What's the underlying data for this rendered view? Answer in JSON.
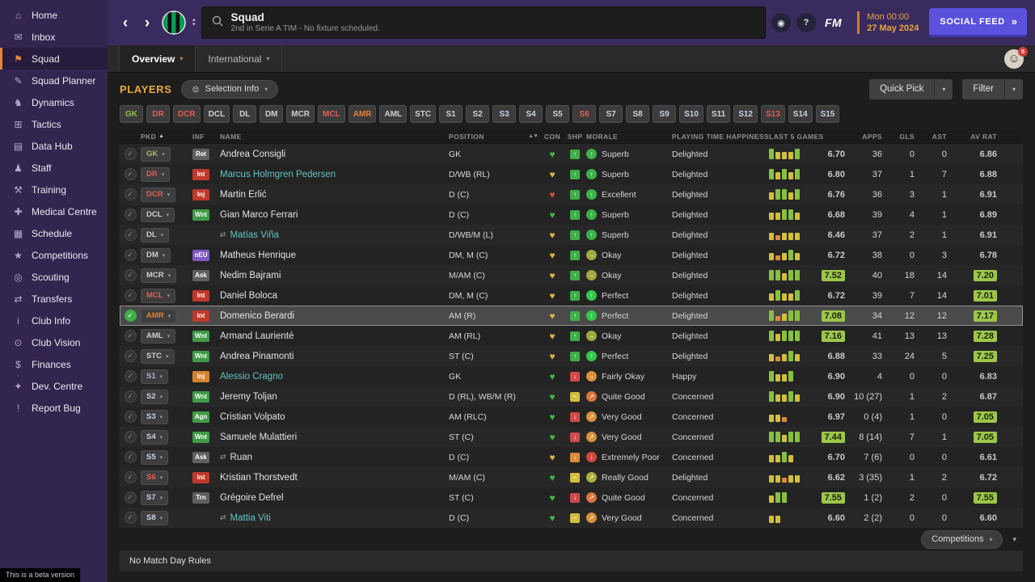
{
  "sidebar": {
    "items": [
      {
        "name": "home",
        "label": "Home",
        "glyph": "⌂"
      },
      {
        "name": "inbox",
        "label": "Inbox",
        "glyph": "✉"
      },
      {
        "name": "squad",
        "label": "Squad",
        "glyph": "⚑",
        "active": true
      },
      {
        "name": "squad-planner",
        "label": "Squad Planner",
        "glyph": "✎"
      },
      {
        "name": "dynamics",
        "label": "Dynamics",
        "glyph": "♞"
      },
      {
        "name": "tactics",
        "label": "Tactics",
        "glyph": "⊞"
      },
      {
        "name": "data-hub",
        "label": "Data Hub",
        "glyph": "▤"
      },
      {
        "name": "staff",
        "label": "Staff",
        "glyph": "♟"
      },
      {
        "name": "training",
        "label": "Training",
        "glyph": "⚒"
      },
      {
        "name": "medical-centre",
        "label": "Medical Centre",
        "glyph": "✚"
      },
      {
        "name": "schedule",
        "label": "Schedule",
        "glyph": "▦"
      },
      {
        "name": "competitions",
        "label": "Competitions",
        "glyph": "★"
      },
      {
        "name": "scouting",
        "label": "Scouting",
        "glyph": "◎"
      },
      {
        "name": "transfers",
        "label": "Transfers",
        "glyph": "⇄"
      },
      {
        "name": "club-info",
        "label": "Club Info",
        "glyph": "i"
      },
      {
        "name": "club-vision",
        "label": "Club Vision",
        "glyph": "⊙"
      },
      {
        "name": "finances",
        "label": "Finances",
        "glyph": "$"
      },
      {
        "name": "dev-centre",
        "label": "Dev. Centre",
        "glyph": "✦"
      },
      {
        "name": "report-bug",
        "label": "Report Bug",
        "glyph": "!"
      }
    ],
    "beta_note": "This is a beta version"
  },
  "topbar": {
    "title": "Squad",
    "subtitle": "2nd in Serie A TIM - No fixture scheduled.",
    "date_line1": "Mon 00:00",
    "date_line2": "27 May 2024",
    "social_feed_label": "SOCIAL FEED"
  },
  "tabbar": {
    "tabs": [
      {
        "label": "Overview"
      },
      {
        "label": "International"
      }
    ],
    "avatar_badge": "5"
  },
  "toolbar": {
    "players_label": "PLAYERS",
    "selection_info_label": "Selection Info",
    "quick_pick_label": "Quick Pick",
    "filter_label": "Filter"
  },
  "position_filters": [
    {
      "label": "GK",
      "color": "#8fbf4d"
    },
    {
      "label": "DR",
      "color": "#e06055"
    },
    {
      "label": "DCR",
      "color": "#e06055"
    },
    {
      "label": "DCL",
      "color": "#cfcfcf"
    },
    {
      "label": "DL",
      "color": "#cfcfcf"
    },
    {
      "label": "DM",
      "color": "#cfcfcf"
    },
    {
      "label": "MCR",
      "color": "#cfcfcf"
    },
    {
      "label": "MCL",
      "color": "#e06055"
    },
    {
      "label": "AMR",
      "color": "#e0813c"
    },
    {
      "label": "AML",
      "color": "#cfcfcf"
    },
    {
      "label": "STC",
      "color": "#cfcfcf"
    },
    {
      "label": "S1",
      "color": "#c9d1e4"
    },
    {
      "label": "S2",
      "color": "#c9d1e4"
    },
    {
      "label": "S3",
      "color": "#c9d1e4"
    },
    {
      "label": "S4",
      "color": "#c9d1e4"
    },
    {
      "label": "S5",
      "color": "#c9d1e4"
    },
    {
      "label": "S6",
      "color": "#e06055"
    },
    {
      "label": "S7",
      "color": "#c9d1e4"
    },
    {
      "label": "S8",
      "color": "#c9d1e4"
    },
    {
      "label": "S9",
      "color": "#c9d1e4"
    },
    {
      "label": "S10",
      "color": "#c9d1e4"
    },
    {
      "label": "S11",
      "color": "#c9d1e4"
    },
    {
      "label": "S12",
      "color": "#c9d1e4"
    },
    {
      "label": "S13",
      "color": "#e06055"
    },
    {
      "label": "S14",
      "color": "#c9d1e4"
    },
    {
      "label": "S15",
      "color": "#c9d1e4"
    }
  ],
  "table": {
    "columns": [
      "PKD",
      "INF",
      "NAME",
      "POSITION",
      "CON",
      "SHP",
      "MORALE",
      "PLAYING TIME HAPPINESS",
      "LAST 5 GAMES",
      "APPS",
      "GLS",
      "AST",
      "AV RAT"
    ],
    "rows": [
      {
        "pkd": "GK",
        "pkd_color": "#a8b868",
        "inf": "Ret",
        "inf_bg": "#5f5f5f",
        "name": "Andrea Consigli",
        "pos": "GK",
        "con": "green",
        "shp": "g",
        "morale": "Superb",
        "morale_color": "#3cb24a",
        "morale_arrow": "↑",
        "happiness": "Delighted",
        "last5": [
          "g",
          "y",
          "y",
          "y",
          "g"
        ],
        "form": "6.70",
        "apps": "36",
        "gls": "0",
        "ast": "0",
        "avrat": "6.86"
      },
      {
        "pkd": "DR",
        "pkd_color": "#e06055",
        "inf": "Int",
        "inf_bg": "#c0392b",
        "name": "Marcus Holmgren Pedersen",
        "link": true,
        "pos": "D/WB (RL)",
        "con": "yellow",
        "shp": "g",
        "morale": "Superb",
        "morale_color": "#3cb24a",
        "morale_arrow": "↑",
        "happiness": "Delighted",
        "last5": [
          "g",
          "y",
          "g",
          "y",
          "g"
        ],
        "form": "6.80",
        "apps": "37",
        "gls": "1",
        "ast": "7",
        "avrat": "6.88"
      },
      {
        "pkd": "DCR",
        "pkd_color": "#e06055",
        "inf": "Inj",
        "inf_bg": "#c0392b",
        "name": "Martin Erlić",
        "pos": "D (C)",
        "con": "red",
        "shp": "g",
        "morale": "Excellent",
        "morale_color": "#3cb24a",
        "morale_arrow": "↑",
        "happiness": "Delighted",
        "last5": [
          "y",
          "g",
          "g",
          "y",
          "g"
        ],
        "form": "6.76",
        "apps": "36",
        "gls": "3",
        "ast": "1",
        "avrat": "6.91"
      },
      {
        "pkd": "DCL",
        "pkd_color": "#cfcfcf",
        "inf": "Wnt",
        "inf_bg": "#3f9b45",
        "name": "Gian Marco Ferrari",
        "pos": "D (C)",
        "con": "green",
        "shp": "g",
        "morale": "Superb",
        "morale_color": "#3cb24a",
        "morale_arrow": "↑",
        "happiness": "Delighted",
        "last5": [
          "y",
          "y",
          "g",
          "g",
          "y"
        ],
        "form": "6.68",
        "apps": "39",
        "gls": "4",
        "ast": "1",
        "avrat": "6.89"
      },
      {
        "pkd": "DL",
        "pkd_color": "#cfcfcf",
        "name": "Matías Viña",
        "link": true,
        "loan": true,
        "pos": "D/WB/M (L)",
        "con": "yellow",
        "shp": "g",
        "morale": "Superb",
        "morale_color": "#3cb24a",
        "morale_arrow": "↑",
        "happiness": "Delighted",
        "last5": [
          "y",
          "o",
          "y",
          "y",
          "y"
        ],
        "form": "6.46",
        "apps": "37",
        "gls": "2",
        "ast": "1",
        "avrat": "6.91"
      },
      {
        "pkd": "DM",
        "pkd_color": "#cfcfcf",
        "inf": "nEU",
        "inf_bg": "#7e57c2",
        "name": "Matheus Henrique",
        "pos": "DM, M (C)",
        "con": "yellow",
        "shp": "g",
        "morale": "Okay",
        "morale_color": "#a0a93b",
        "morale_arrow": "→",
        "happiness": "Delighted",
        "last5": [
          "y",
          "o",
          "y",
          "g",
          "y"
        ],
        "form": "6.72",
        "apps": "38",
        "gls": "0",
        "ast": "3",
        "avrat": "6.78"
      },
      {
        "pkd": "MCR",
        "pkd_color": "#cfcfcf",
        "inf": "Ask",
        "inf_bg": "#5f5f5f",
        "name": "Nedim Bajrami",
        "pos": "M/AM (C)",
        "con": "yellow",
        "shp": "g",
        "morale": "Okay",
        "morale_color": "#a0a93b",
        "morale_arrow": "→",
        "happiness": "Delighted",
        "last5": [
          "g",
          "g",
          "y",
          "g",
          "g"
        ],
        "form": "7.52",
        "form_badge": true,
        "apps": "40",
        "gls": "18",
        "ast": "14",
        "avrat": "7.20",
        "avrat_badge": true
      },
      {
        "pkd": "MCL",
        "pkd_color": "#e06055",
        "inf": "Int",
        "inf_bg": "#c0392b",
        "name": "Daniel Boloca",
        "pos": "DM, M (C)",
        "con": "yellow",
        "shp": "g",
        "morale": "Perfect",
        "morale_color": "#35c94b",
        "morale_arrow": "↑",
        "happiness": "Delighted",
        "last5": [
          "y",
          "g",
          "y",
          "y",
          "g"
        ],
        "form": "6.72",
        "apps": "39",
        "gls": "7",
        "ast": "14",
        "avrat": "7.01",
        "avrat_badge": true
      },
      {
        "pkd": "AMR",
        "pkd_color": "#e0813c",
        "inf": "Int",
        "inf_bg": "#c0392b",
        "name": "Domenico Berardi",
        "pos": "AM (R)",
        "con": "yellow",
        "shp": "g",
        "morale": "Perfect",
        "morale_color": "#35c94b",
        "morale_arrow": "↑",
        "happiness": "Delighted",
        "last5": [
          "g",
          "o",
          "y",
          "g",
          "g"
        ],
        "form": "7.08",
        "form_badge": true,
        "apps": "34",
        "gls": "12",
        "ast": "12",
        "avrat": "7.17",
        "avrat_badge": true,
        "selected": true
      },
      {
        "pkd": "AML",
        "pkd_color": "#cfcfcf",
        "inf": "Wnt",
        "inf_bg": "#3f9b45",
        "name": "Armand Laurienté",
        "pos": "AM (RL)",
        "con": "yellow",
        "shp": "g",
        "morale": "Okay",
        "morale_color": "#a0a93b",
        "morale_arrow": "→",
        "happiness": "Delighted",
        "last5": [
          "g",
          "y",
          "g",
          "g",
          "g"
        ],
        "form": "7.16",
        "form_badge": true,
        "apps": "41",
        "gls": "13",
        "ast": "13",
        "avrat": "7.28",
        "avrat_badge": true
      },
      {
        "pkd": "STC",
        "pkd_color": "#cfcfcf",
        "inf": "Wnt",
        "inf_bg": "#3f9b45",
        "name": "Andrea Pinamonti",
        "pos": "ST (C)",
        "con": "yellow",
        "shp": "g",
        "morale": "Perfect",
        "morale_color": "#35c94b",
        "morale_arrow": "↑",
        "happiness": "Delighted",
        "last5": [
          "y",
          "o",
          "y",
          "g",
          "y"
        ],
        "form": "6.88",
        "apps": "33",
        "gls": "24",
        "ast": "5",
        "avrat": "7.25",
        "avrat_badge": true
      },
      {
        "pkd": "S1",
        "pkd_color": "#b9a8e0",
        "inf": "Inj",
        "inf_bg": "#d5832f",
        "name": "Alessio Cragno",
        "link": true,
        "pos": "GK",
        "con": "green",
        "shp": "r",
        "morale": "Fairly Okay",
        "morale_color": "#d8923a",
        "morale_arrow": "→",
        "happiness": "Happy",
        "last5": [
          "g",
          "y",
          "y",
          "g"
        ],
        "form": "6.90",
        "apps": "4",
        "gls": "0",
        "ast": "0",
        "avrat": "6.83"
      },
      {
        "pkd": "S2",
        "pkd_color": "#c9d1e4",
        "inf": "Wnt",
        "inf_bg": "#3f9b45",
        "name": "Jeremy Toljan",
        "pos": "D (RL), WB/M (R)",
        "con": "green",
        "shp": "y",
        "morale": "Quite Good",
        "morale_color": "#d8763a",
        "morale_arrow": "↗",
        "happiness": "Concerned",
        "last5": [
          "g",
          "y",
          "y",
          "g",
          "y"
        ],
        "form": "6.90",
        "apps": "10 (27)",
        "gls": "1",
        "ast": "2",
        "avrat": "6.87"
      },
      {
        "pkd": "S3",
        "pkd_color": "#c9d1e4",
        "inf": "Agn",
        "inf_bg": "#3f9b45",
        "name": "Cristian Volpato",
        "pos": "AM (RLC)",
        "con": "green",
        "shp": "r",
        "morale": "Very Good",
        "morale_color": "#d8923a",
        "morale_arrow": "↗",
        "happiness": "Concerned",
        "last5": [
          "y",
          "y",
          "o"
        ],
        "form": "6.97",
        "apps": "0 (4)",
        "gls": "1",
        "ast": "0",
        "avrat": "7.05",
        "avrat_badge": true
      },
      {
        "pkd": "S4",
        "pkd_color": "#c9d1e4",
        "inf": "Wnt",
        "inf_bg": "#3f9b45",
        "name": "Samuele Mulattieri",
        "pos": "ST (C)",
        "con": "green",
        "shp": "r",
        "morale": "Very Good",
        "morale_color": "#d8923a",
        "morale_arrow": "↗",
        "happiness": "Concerned",
        "last5": [
          "g",
          "g",
          "y",
          "g",
          "g"
        ],
        "form": "7.44",
        "form_badge": true,
        "apps": "8 (14)",
        "gls": "7",
        "ast": "1",
        "avrat": "7.05",
        "avrat_badge": true
      },
      {
        "pkd": "S5",
        "pkd_color": "#c9d1e4",
        "inf": "Ask",
        "inf_bg": "#5f5f5f",
        "name": "Ruan",
        "loan": true,
        "pos": "D (C)",
        "con": "yellow",
        "shp": "o",
        "morale": "Extremely Poor",
        "morale_color": "#d24840",
        "morale_arrow": "↓",
        "happiness": "Concerned",
        "last5": [
          "y",
          "y",
          "g",
          "y"
        ],
        "form": "6.70",
        "apps": "7 (6)",
        "gls": "0",
        "ast": "0",
        "avrat": "6.61"
      },
      {
        "pkd": "S6",
        "pkd_color": "#e06055",
        "inf": "Int",
        "inf_bg": "#c0392b",
        "name": "Kristian Thorstvedt",
        "pos": "M/AM (C)",
        "con": "green",
        "shp": "y",
        "morale": "Really Good",
        "morale_color": "#aab23b",
        "morale_arrow": "↗",
        "happiness": "Delighted",
        "last5": [
          "y",
          "y",
          "o",
          "y",
          "y"
        ],
        "form": "6.62",
        "apps": "3 (35)",
        "gls": "1",
        "ast": "2",
        "avrat": "6.72"
      },
      {
        "pkd": "S7",
        "pkd_color": "#c9d1e4",
        "inf": "Trn",
        "inf_bg": "#5f5f5f",
        "name": "Grégoire Defrel",
        "pos": "ST (C)",
        "con": "green",
        "shp": "r",
        "morale": "Quite Good",
        "morale_color": "#d8763a",
        "morale_arrow": "↗",
        "happiness": "Concerned",
        "last5": [
          "y",
          "g",
          "g"
        ],
        "form": "7.55",
        "form_badge": true,
        "apps": "1 (2)",
        "gls": "2",
        "ast": "0",
        "avrat": "7.55",
        "avrat_badge": true
      },
      {
        "pkd": "S8",
        "pkd_color": "#c9d1e4",
        "name": "Mattia Viti",
        "link": true,
        "loan": true,
        "pos": "D (C)",
        "con": "green",
        "shp": "y",
        "morale": "Very Good",
        "morale_color": "#d8923a",
        "morale_arrow": "↗",
        "happiness": "Concerned",
        "last5": [
          "y",
          "y"
        ],
        "form": "6.60",
        "apps": "2 (2)",
        "gls": "0",
        "ast": "0",
        "avrat": "6.60"
      }
    ]
  },
  "footer": {
    "competitions_label": "Competitions",
    "no_match_day_rules": "No Match Day Rules"
  }
}
